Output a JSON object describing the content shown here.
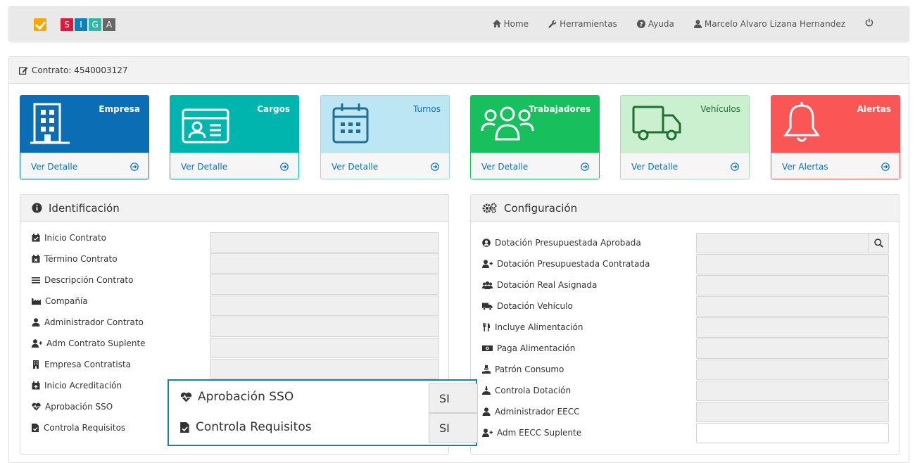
{
  "brand": {
    "letters": [
      "S",
      "I",
      "G",
      "A"
    ],
    "letter_colors": [
      "#e0183c",
      "#0f80b8",
      "#2fb6a7",
      "#666666"
    ],
    "check_color": "#f5a800"
  },
  "nav": {
    "home": "Home",
    "tools": "Herramientas",
    "help": "Ayuda",
    "user": "Marcelo Alvaro Lizana Hernandez"
  },
  "contract": {
    "label": "Contrato: 4540003127"
  },
  "tiles": [
    {
      "title": "Empresa",
      "link": "Ver Detalle",
      "icon": "building-icon",
      "color": "#0b6db3"
    },
    {
      "title": "Cargos",
      "link": "Ver Detalle",
      "icon": "id-card-icon",
      "color": "#00b5ad"
    },
    {
      "title": "Turnos",
      "link": "Ver Detalle",
      "icon": "calendar-icon",
      "color": "#bde6f3"
    },
    {
      "title": "Trabajadores",
      "link": "Ver Detalle",
      "icon": "users-icon",
      "color": "#17bf5d"
    },
    {
      "title": "Vehículos",
      "link": "Ver Detalle",
      "icon": "truck-icon",
      "color": "#caf0cf"
    },
    {
      "title": "Alertas",
      "link": "Ver Alertas",
      "icon": "bell-icon",
      "color": "#fb5656"
    }
  ],
  "identificacion": {
    "title": "Identificación",
    "rows": [
      {
        "label": "Inicio Contrato",
        "icon": "calendar-check-icon"
      },
      {
        "label": "Término Contrato",
        "icon": "calendar-times-icon"
      },
      {
        "label": "Descripción Contrato",
        "icon": "list-icon"
      },
      {
        "label": "Compañía",
        "icon": "industry-icon"
      },
      {
        "label": "Administrador Contrato",
        "icon": "user-icon"
      },
      {
        "label": "Adm Contrato Suplente",
        "icon": "user-plus-icon"
      },
      {
        "label": "Empresa Contratista",
        "icon": "building-small-icon"
      },
      {
        "label": "Inicio Acreditación",
        "icon": "calendar-plus-icon"
      },
      {
        "label": "Aprobación SSO",
        "icon": "heartbeat-icon"
      },
      {
        "label": "Controla Requisitos",
        "icon": "file-check-icon"
      }
    ]
  },
  "configuracion": {
    "title": "Configuración",
    "rows": [
      {
        "label": "Dotación Presupuestada Aprobada",
        "icon": "user-circle-icon"
      },
      {
        "label": "Dotación Presupuestada Contratada",
        "icon": "user-plus-icon"
      },
      {
        "label": "Dotación Real Asignada",
        "icon": "users-icon"
      },
      {
        "label": "Dotación Vehículo",
        "icon": "truck-icon"
      },
      {
        "label": "Incluye Alimentación",
        "icon": "utensils-icon"
      },
      {
        "label": "Paga Alimentación",
        "icon": "money-icon"
      },
      {
        "label": "Patrón Consumo",
        "icon": "hand-holding-icon"
      },
      {
        "label": "Controla Dotación",
        "icon": "person-arrow-icon"
      },
      {
        "label": "Administrador EECC",
        "icon": "user-icon"
      },
      {
        "label": "Adm EECC Suplente",
        "icon": "user-plus-icon"
      }
    ]
  },
  "zoom": {
    "rows": [
      {
        "label": "Aprobación SSO",
        "value": "SI"
      },
      {
        "label": "Controla Requisitos",
        "value": "SI"
      }
    ]
  }
}
